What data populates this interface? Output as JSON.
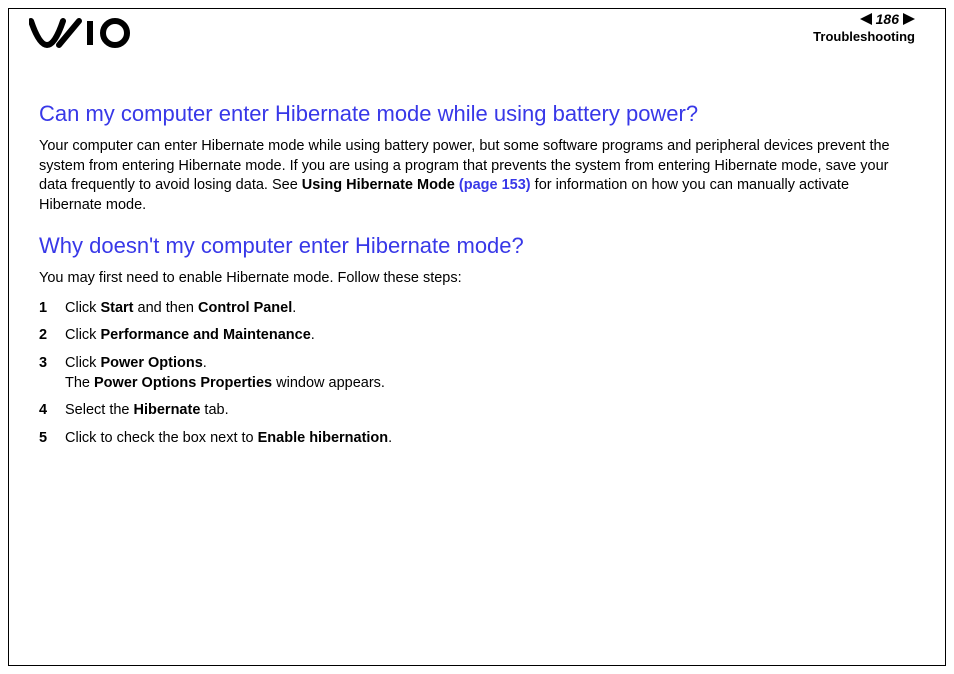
{
  "header": {
    "page_number": "186",
    "section": "Troubleshooting"
  },
  "q1": {
    "heading": "Can my computer enter Hibernate mode while using battery power?",
    "para_pre": "Your computer can enter Hibernate mode while using battery power, but some software programs and peripheral devices prevent the system from entering Hibernate mode. If you are using a program that prevents the system from entering Hibernate mode, save your data frequently to avoid losing data. See ",
    "bold_text": "Using Hibernate Mode ",
    "link_text": "(page 153)",
    "para_post": " for information on how you can manually activate Hibernate mode."
  },
  "q2": {
    "heading": "Why doesn't my computer enter Hibernate mode?",
    "intro": "You may first need to enable Hibernate mode. Follow these steps:",
    "steps": [
      {
        "n": "1",
        "pre": "Click ",
        "b1": "Start",
        "mid": " and then ",
        "b2": "Control Panel",
        "post": "."
      },
      {
        "n": "2",
        "pre": "Click ",
        "b1": "Performance and Maintenance",
        "post": "."
      },
      {
        "n": "3",
        "pre": "Click ",
        "b1": "Power Options",
        "post": ".",
        "line2_pre": "The ",
        "line2_b": "Power Options Properties",
        "line2_post": " window appears."
      },
      {
        "n": "4",
        "pre": "Select the ",
        "b1": "Hibernate",
        "post": " tab."
      },
      {
        "n": "5",
        "pre": "Click to check the box next to ",
        "b1": "Enable hibernation",
        "post": "."
      }
    ]
  }
}
